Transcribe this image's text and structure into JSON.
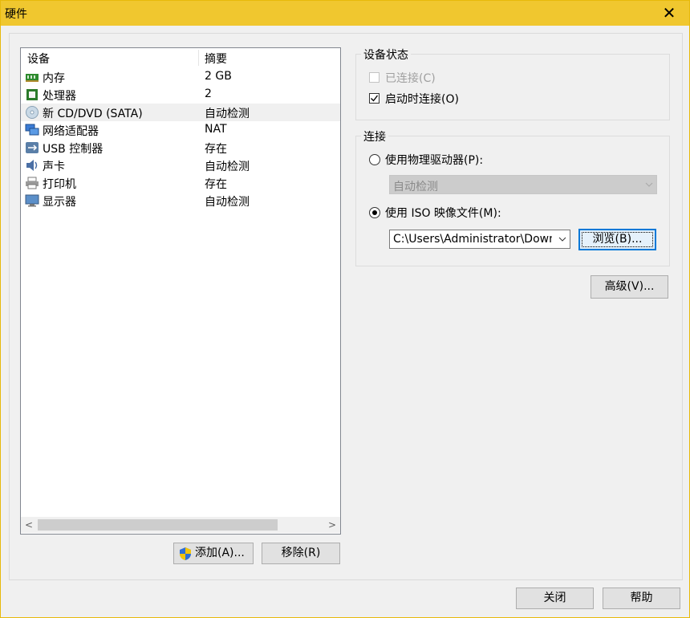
{
  "window": {
    "title": "硬件",
    "close_label": "✕"
  },
  "device_list": {
    "columns": {
      "device": "设备",
      "summary": "摘要"
    },
    "rows": [
      {
        "name": "内存",
        "summary": "2 GB",
        "icon": "memory-icon"
      },
      {
        "name": "处理器",
        "summary": "2",
        "icon": "processor-icon"
      },
      {
        "name": "新 CD/DVD (SATA)",
        "summary": "自动检测",
        "icon": "cd-dvd-icon",
        "selected": true
      },
      {
        "name": "网络适配器",
        "summary": "NAT",
        "icon": "network-adapter-icon"
      },
      {
        "name": "USB 控制器",
        "summary": "存在",
        "icon": "usb-icon"
      },
      {
        "name": "声卡",
        "summary": "自动检测",
        "icon": "sound-card-icon"
      },
      {
        "name": "打印机",
        "summary": "存在",
        "icon": "printer-icon"
      },
      {
        "name": "显示器",
        "summary": "自动检测",
        "icon": "display-icon"
      }
    ],
    "scroll_left": "<",
    "scroll_right": ">"
  },
  "buttons": {
    "add": "添加(A)...",
    "remove": "移除(R)",
    "browse": "浏览(B)...",
    "advanced": "高级(V)...",
    "close": "关闭",
    "help": "帮助"
  },
  "device_status": {
    "title": "设备状态",
    "connected": {
      "label": "已连接(C)",
      "checked": false,
      "enabled": false
    },
    "connect_at_power_on": {
      "label": "启动时连接(O)",
      "checked": true,
      "enabled": true
    }
  },
  "connection": {
    "title": "连接",
    "physical_drive": {
      "label": "使用物理驱动器(P):",
      "selected": false
    },
    "physical_drive_select": {
      "value": "自动检测",
      "enabled": false
    },
    "iso_image": {
      "label": "使用 ISO 映像文件(M):",
      "selected": true
    },
    "iso_path": {
      "value": "C:\\Users\\Administrator\\Downlo"
    }
  }
}
